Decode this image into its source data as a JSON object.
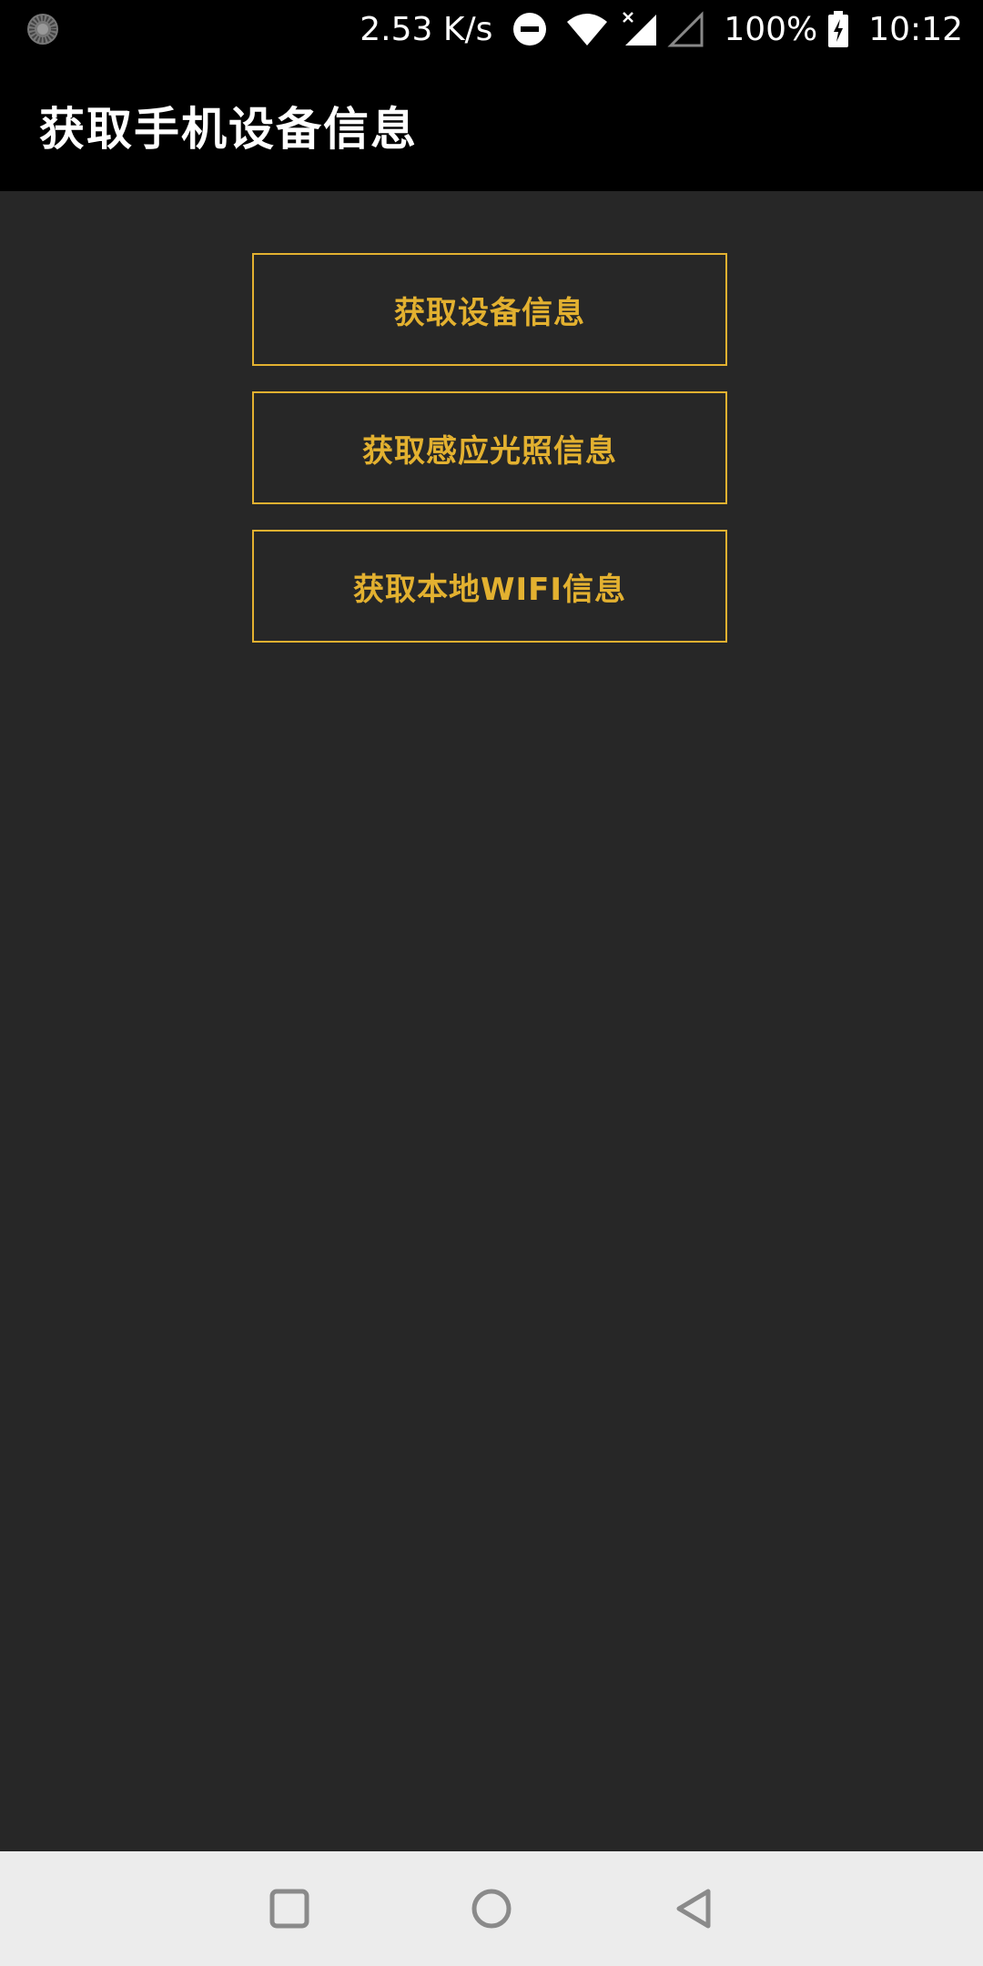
{
  "status_bar": {
    "loader_icon": "loading-spinner-icon",
    "net_speed": "2.53 K/s",
    "dnd_icon": "do-not-disturb-icon",
    "wifi_icon": "wifi-icon",
    "signal_icon": "cellular-signal-no-data-icon",
    "signal2_icon": "cellular-signal-empty-icon",
    "battery_percent": "100%",
    "battery_icon": "battery-charging-icon",
    "time": "10:12"
  },
  "app_bar": {
    "title": "获取手机设备信息"
  },
  "buttons": [
    {
      "label": "获取设备信息"
    },
    {
      "label": "获取感应光照信息"
    },
    {
      "label": "获取本地WIFI信息"
    }
  ],
  "nav_bar": {
    "recent_icon": "recent-apps-square-icon",
    "home_icon": "home-circle-icon",
    "back_icon": "back-triangle-icon"
  },
  "colors": {
    "accent": "#e3b130",
    "background": "#272727",
    "app_bar": "#000000",
    "nav_bar": "#ececec"
  }
}
